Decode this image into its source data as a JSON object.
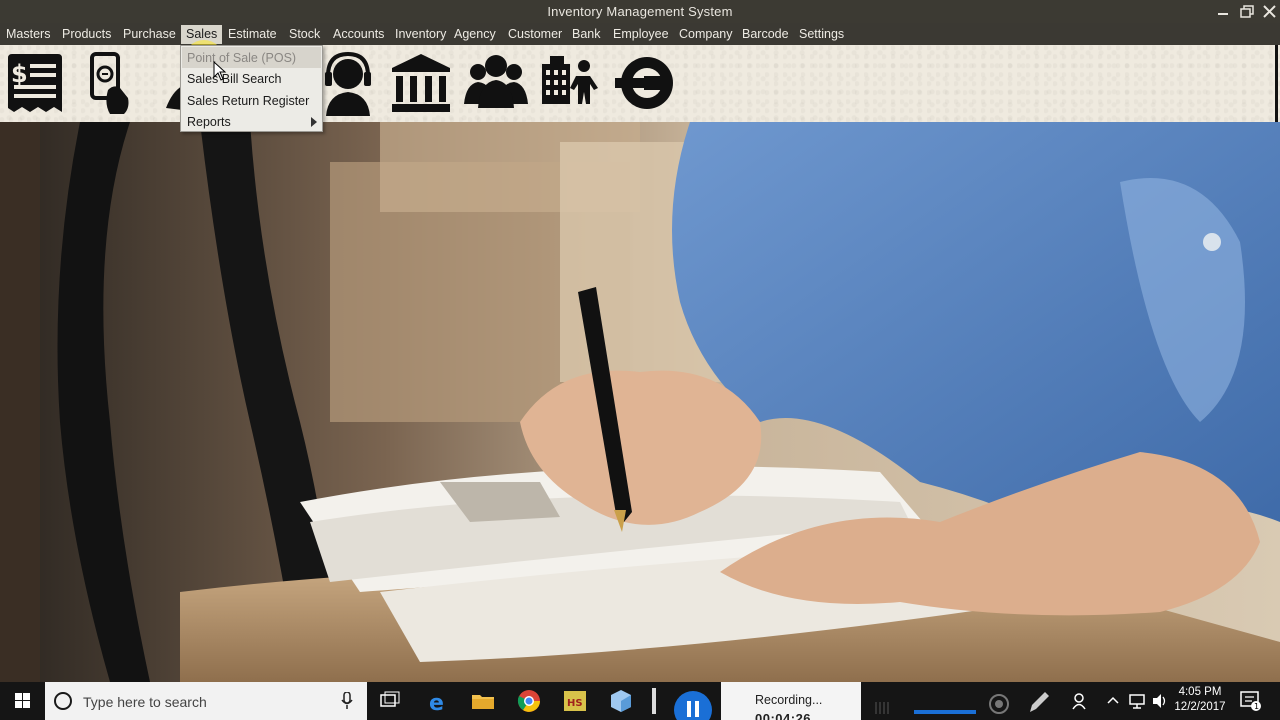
{
  "window": {
    "title": "Inventory Management System"
  },
  "menubar": {
    "items": [
      {
        "label": "Masters"
      },
      {
        "label": "Products"
      },
      {
        "label": "Purchase"
      },
      {
        "label": "Sales"
      },
      {
        "label": "Estimate"
      },
      {
        "label": "Stock"
      },
      {
        "label": "Accounts"
      },
      {
        "label": "Inventory"
      },
      {
        "label": "Agency"
      },
      {
        "label": "Customer"
      },
      {
        "label": "Bank"
      },
      {
        "label": "Employee"
      },
      {
        "label": "Company"
      },
      {
        "label": "Barcode"
      },
      {
        "label": "Settings"
      }
    ],
    "active": "Sales"
  },
  "sales_menu": {
    "items": [
      {
        "label": "Point of Sale (POS)"
      },
      {
        "label": "Sales Bill Search"
      },
      {
        "label": "Sales Return Register"
      },
      {
        "label": "Reports"
      }
    ]
  },
  "toolbar": {
    "icons": [
      "invoice-icon",
      "mobile-payment-icon",
      "partial-icon",
      "support-agent-icon",
      "bank-icon",
      "group-icon",
      "building-person-icon",
      "logout-icon"
    ]
  },
  "taskbar": {
    "search_placeholder": "Type here to search",
    "recording_label": "Recording...",
    "recording_time": "00:04:26",
    "clock_time": "4:05 PM",
    "clock_date": "12/2/2017",
    "notification_count": "1"
  },
  "colors": {
    "titlebar": "#3c3a33",
    "toolbar_bg": "#efeadf",
    "menu_hover": "#d7d4cc",
    "recording_blue": "#1a6fd6"
  }
}
